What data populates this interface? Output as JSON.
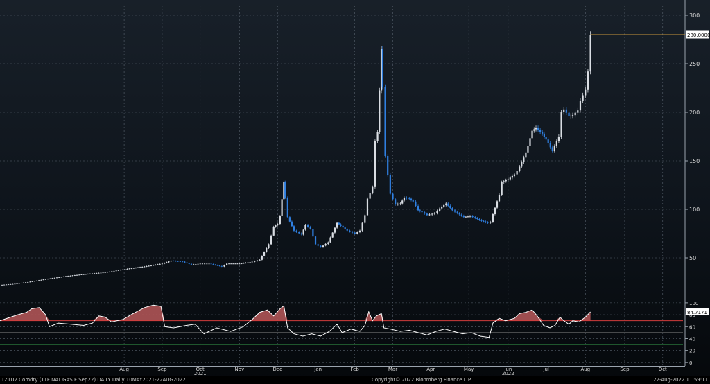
{
  "chart_data": [
    {
      "type": "candlestick",
      "title": "",
      "ylim": [
        10,
        310
      ],
      "yticks": [
        50,
        100,
        150,
        200,
        250,
        300
      ],
      "last_price_label": "280.0000",
      "last_price": 280,
      "grid": true,
      "colors": {
        "up": "#d9dde3",
        "down": "#2f7fe0",
        "last": "#c8963c"
      },
      "points": [
        [
          "2021-05-10",
          22
        ],
        [
          "2021-05-20",
          23
        ],
        [
          "2021-06-01",
          25
        ],
        [
          "2021-06-15",
          28
        ],
        [
          "2021-07-01",
          31
        ],
        [
          "2021-07-15",
          33
        ],
        [
          "2021-08-01",
          35
        ],
        [
          "2021-08-15",
          38
        ],
        [
          "2021-09-01",
          41
        ],
        [
          "2021-09-15",
          44
        ],
        [
          "2021-09-22",
          47
        ],
        [
          "2021-10-01",
          46
        ],
        [
          "2021-10-08",
          43
        ],
        [
          "2021-10-15",
          44
        ],
        [
          "2021-10-22",
          44
        ],
        [
          "2021-11-01",
          41
        ],
        [
          "2021-11-05",
          44
        ],
        [
          "2021-11-15",
          44
        ],
        [
          "2021-11-25",
          46
        ],
        [
          "2021-12-01",
          48
        ],
        [
          "2021-12-08",
          64
        ],
        [
          "2021-12-12",
          82
        ],
        [
          "2021-12-15",
          85
        ],
        [
          "2021-12-17",
          93
        ],
        [
          "2021-12-20",
          128
        ],
        [
          "2021-12-21",
          112
        ],
        [
          "2021-12-23",
          92
        ],
        [
          "2021-12-28",
          78
        ],
        [
          "2022-01-03",
          74
        ],
        [
          "2022-01-06",
          84
        ],
        [
          "2022-01-10",
          80
        ],
        [
          "2022-01-14",
          64
        ],
        [
          "2022-01-18",
          61
        ],
        [
          "2022-01-24",
          66
        ],
        [
          "2022-01-31",
          86
        ],
        [
          "2022-02-03",
          83
        ],
        [
          "2022-02-08",
          78
        ],
        [
          "2022-02-14",
          75
        ],
        [
          "2022-02-18",
          78
        ],
        [
          "2022-02-22",
          94
        ],
        [
          "2022-02-24",
          111
        ],
        [
          "2022-02-28",
          123
        ],
        [
          "2022-03-02",
          170
        ],
        [
          "2022-03-04",
          180
        ],
        [
          "2022-03-07",
          265
        ],
        [
          "2022-03-08",
          226
        ],
        [
          "2022-03-10",
          155
        ],
        [
          "2022-03-14",
          116
        ],
        [
          "2022-03-18",
          105
        ],
        [
          "2022-03-22",
          106
        ],
        [
          "2022-03-25",
          112
        ],
        [
          "2022-03-29",
          111
        ],
        [
          "2022-04-01",
          108
        ],
        [
          "2022-04-05",
          99
        ],
        [
          "2022-04-08",
          97
        ],
        [
          "2022-04-12",
          94
        ],
        [
          "2022-04-18",
          96
        ],
        [
          "2022-04-22",
          101
        ],
        [
          "2022-04-27",
          106
        ],
        [
          "2022-05-02",
          99
        ],
        [
          "2022-05-06",
          96
        ],
        [
          "2022-05-11",
          92
        ],
        [
          "2022-05-16",
          93
        ],
        [
          "2022-05-20",
          91
        ],
        [
          "2022-05-25",
          88
        ],
        [
          "2022-05-30",
          86
        ],
        [
          "2022-06-01",
          87
        ],
        [
          "2022-06-03",
          95
        ],
        [
          "2022-06-08",
          115
        ],
        [
          "2022-06-10",
          128
        ],
        [
          "2022-06-15",
          131
        ],
        [
          "2022-06-20",
          136
        ],
        [
          "2022-06-24",
          144
        ],
        [
          "2022-06-29",
          158
        ],
        [
          "2022-07-04",
          181
        ],
        [
          "2022-07-07",
          184
        ],
        [
          "2022-07-12",
          178
        ],
        [
          "2022-07-15",
          172
        ],
        [
          "2022-07-20",
          160
        ],
        [
          "2022-07-25",
          175
        ],
        [
          "2022-07-27",
          200
        ],
        [
          "2022-07-29",
          203
        ],
        [
          "2022-08-02",
          196
        ],
        [
          "2022-08-05",
          197
        ],
        [
          "2022-08-09",
          202
        ],
        [
          "2022-08-11",
          212
        ],
        [
          "2022-08-15",
          223
        ],
        [
          "2022-08-17",
          242
        ],
        [
          "2022-08-19",
          280
        ]
      ]
    },
    {
      "type": "line",
      "title": "",
      "ylim": [
        -6,
        108
      ],
      "yticks": [
        0,
        20,
        40,
        60,
        80,
        100
      ],
      "last_value_label": "84.7171",
      "last_value": 84.7171,
      "overbought": 70,
      "oversold": 30,
      "colors": {
        "line": "#ffffff",
        "fill": "#b8595a",
        "overbought": "#d23c3c",
        "oversold": "#37a04b",
        "mid": "#888888"
      },
      "points": [
        [
          "2021-05-10",
          70
        ],
        [
          "2021-05-17",
          75
        ],
        [
          "2021-05-24",
          80
        ],
        [
          "2021-05-31",
          84
        ],
        [
          "2021-06-04",
          90
        ],
        [
          "2021-06-10",
          92
        ],
        [
          "2021-06-15",
          80
        ],
        [
          "2021-06-18",
          60
        ],
        [
          "2021-06-25",
          66
        ],
        [
          "2021-07-05",
          64
        ],
        [
          "2021-07-15",
          62
        ],
        [
          "2021-07-22",
          66
        ],
        [
          "2021-07-27",
          78
        ],
        [
          "2021-08-01",
          76
        ],
        [
          "2021-08-06",
          68
        ],
        [
          "2021-08-15",
          72
        ],
        [
          "2021-08-23",
          82
        ],
        [
          "2021-09-01",
          92
        ],
        [
          "2021-09-08",
          96
        ],
        [
          "2021-09-14",
          94
        ],
        [
          "2021-09-17",
          60
        ],
        [
          "2021-09-24",
          58
        ],
        [
          "2021-10-04",
          62
        ],
        [
          "2021-10-11",
          64
        ],
        [
          "2021-10-18",
          48
        ],
        [
          "2021-10-28",
          58
        ],
        [
          "2021-11-08",
          52
        ],
        [
          "2021-11-18",
          60
        ],
        [
          "2021-11-25",
          72
        ],
        [
          "2021-12-01",
          84
        ],
        [
          "2021-12-07",
          88
        ],
        [
          "2021-12-12",
          78
        ],
        [
          "2021-12-17",
          90
        ],
        [
          "2021-12-20",
          95
        ],
        [
          "2021-12-23",
          58
        ],
        [
          "2021-12-28",
          48
        ],
        [
          "2022-01-04",
          44
        ],
        [
          "2022-01-11",
          48
        ],
        [
          "2022-01-18",
          44
        ],
        [
          "2022-01-25",
          52
        ],
        [
          "2022-01-31",
          64
        ],
        [
          "2022-02-04",
          50
        ],
        [
          "2022-02-11",
          56
        ],
        [
          "2022-02-18",
          52
        ],
        [
          "2022-02-22",
          62
        ],
        [
          "2022-02-25",
          85
        ],
        [
          "2022-02-28",
          70
        ],
        [
          "2022-03-03",
          78
        ],
        [
          "2022-03-07",
          82
        ],
        [
          "2022-03-09",
          58
        ],
        [
          "2022-03-14",
          56
        ],
        [
          "2022-03-22",
          52
        ],
        [
          "2022-03-29",
          54
        ],
        [
          "2022-04-05",
          50
        ],
        [
          "2022-04-12",
          46
        ],
        [
          "2022-04-19",
          52
        ],
        [
          "2022-04-26",
          56
        ],
        [
          "2022-05-03",
          52
        ],
        [
          "2022-05-10",
          48
        ],
        [
          "2022-05-17",
          50
        ],
        [
          "2022-05-24",
          44
        ],
        [
          "2022-05-31",
          42
        ],
        [
          "2022-06-03",
          66
        ],
        [
          "2022-06-08",
          74
        ],
        [
          "2022-06-13",
          70
        ],
        [
          "2022-06-20",
          74
        ],
        [
          "2022-06-24",
          82
        ],
        [
          "2022-06-29",
          84
        ],
        [
          "2022-07-04",
          88
        ],
        [
          "2022-07-08",
          78
        ],
        [
          "2022-07-13",
          62
        ],
        [
          "2022-07-18",
          58
        ],
        [
          "2022-07-22",
          62
        ],
        [
          "2022-07-26",
          76
        ],
        [
          "2022-07-29",
          70
        ],
        [
          "2022-08-02",
          64
        ],
        [
          "2022-08-05",
          70
        ],
        [
          "2022-08-10",
          68
        ],
        [
          "2022-08-15",
          76
        ],
        [
          "2022-08-19",
          84.7
        ]
      ]
    }
  ],
  "xaxis": {
    "months": [
      {
        "label": "Aug",
        "date": "2021-08-16"
      },
      {
        "label": "Sep",
        "date": "2021-09-15"
      },
      {
        "label": "Oct",
        "date": "2021-10-15"
      },
      {
        "label": "Nov",
        "date": "2021-11-15"
      },
      {
        "label": "Dec",
        "date": "2021-12-15"
      },
      {
        "label": "Jan",
        "date": "2022-01-16"
      },
      {
        "label": "Feb",
        "date": "2022-02-14"
      },
      {
        "label": "Mar",
        "date": "2022-03-16"
      },
      {
        "label": "Apr",
        "date": "2022-04-15"
      },
      {
        "label": "May",
        "date": "2022-05-15"
      },
      {
        "label": "Jun",
        "date": "2022-06-15"
      },
      {
        "label": "Jul",
        "date": "2022-07-15"
      },
      {
        "label": "Aug",
        "date": "2022-08-15"
      },
      {
        "label": "Sep",
        "date": "2022-09-15"
      },
      {
        "label": "Oct",
        "date": "2022-10-15"
      }
    ],
    "years": [
      {
        "label": "2021",
        "date": "2021-10-15"
      },
      {
        "label": "2022",
        "date": "2022-06-15"
      }
    ]
  },
  "footer": {
    "left": "TZTU2 Comdty (TTF NAT GAS F   Sep22) DAILY  Daily 10MAY2021-22AUG2022",
    "center": "Copyright© 2022 Bloomberg Finance L.P.",
    "right": "22-Aug-2022 11:59:11"
  }
}
